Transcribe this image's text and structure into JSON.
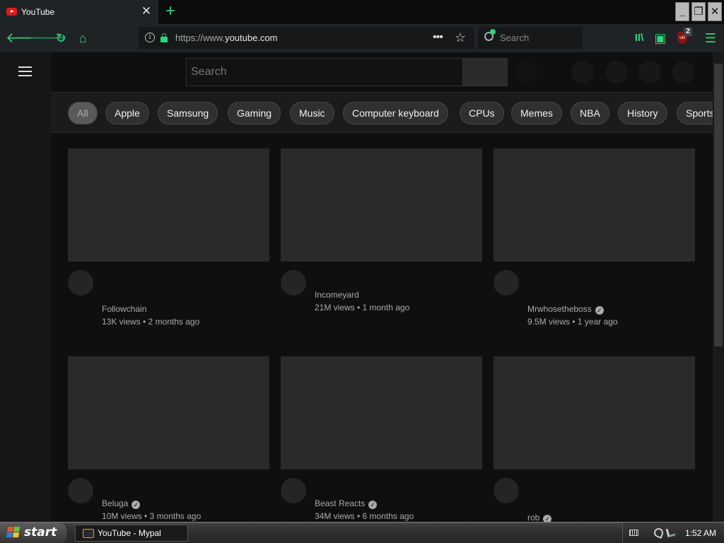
{
  "browser": {
    "tab": {
      "title": "YouTube",
      "close_glyph": "✕"
    },
    "new_tab_glyph": "+",
    "window_controls": {
      "minimize": "_",
      "maximize": "❐",
      "close": "✕"
    },
    "nav": {
      "back_glyph": "🡐",
      "forward_glyph": "🡒",
      "reload_glyph": "↻",
      "home_glyph": "⌂"
    },
    "url": {
      "prefix": "https://www.",
      "domain": "youtube.com",
      "suffix": ""
    },
    "page_actions": {
      "more_glyph": "•••",
      "bookmark_glyph": "☆"
    },
    "search_bar": {
      "placeholder": "Search"
    },
    "toolbar": {
      "library_glyph": "II\\",
      "sidebar_glyph": "▣",
      "ublock_label": "uo",
      "ublock_badge": "2",
      "menu_glyph": "☰"
    }
  },
  "youtube": {
    "search": {
      "placeholder": "Search"
    },
    "chips": [
      {
        "label": "All",
        "active": true
      },
      {
        "label": "Apple"
      },
      {
        "label": "Samsung"
      },
      {
        "label": "Gaming"
      },
      {
        "label": "Music"
      },
      {
        "label": "Computer keyboard"
      },
      {
        "label": "CPUs"
      },
      {
        "label": "Memes"
      },
      {
        "label": "NBA"
      },
      {
        "label": "History"
      },
      {
        "label": "Sports"
      }
    ],
    "videos": [
      {
        "channel": "Followchain",
        "verified": false,
        "stats": "13K views • 2 months ago"
      },
      {
        "channel": "Incomeyard",
        "verified": false,
        "stats": "21M views • 1 month ago"
      },
      {
        "channel": "Mrwhosetheboss",
        "verified": true,
        "stats": "9.5M views • 1 year ago"
      },
      {
        "channel": "Beluga",
        "verified": true,
        "stats": "10M views • 3 months ago"
      },
      {
        "channel": "Beast Reacts",
        "verified": true,
        "stats": "34M views • 6 months ago"
      },
      {
        "channel": "rob",
        "verified": true,
        "stats": ""
      }
    ],
    "verified_glyph": "✓"
  },
  "taskbar": {
    "start_label": "start",
    "task_label": "YouTube - Mypal",
    "clock": "1:52 AM"
  },
  "colors": {
    "accent": "#2dd47c",
    "background": "#0f0f0f",
    "chip_bg": "#303030",
    "thumb_bg": "#2a2a2a"
  }
}
